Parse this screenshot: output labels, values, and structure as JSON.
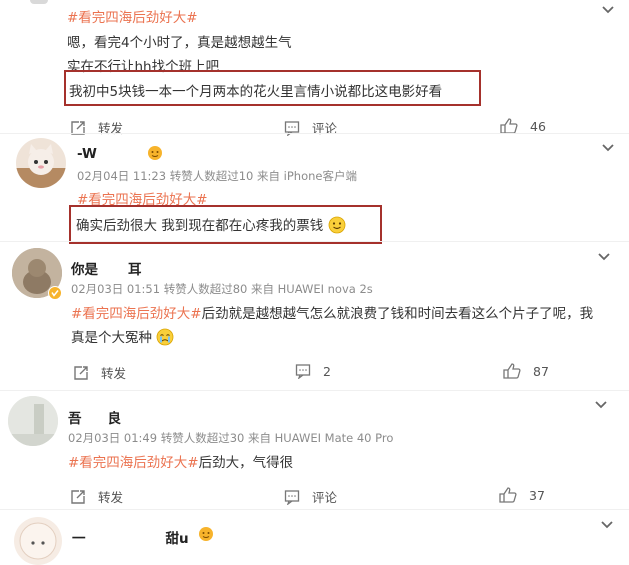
{
  "colors": {
    "tag": "#eb7350",
    "highlight_box": "#a5312c",
    "meta": "#8c8c8c"
  },
  "post1": {
    "hashtag": "#看完四海后劲好大#",
    "line1": "嗯，看完4个小时了，真是越想越生气",
    "line2": "实在不行让hh找个班上吧",
    "line3": "我初中5块钱一本一个月两本的花火里言情小说都比这电影好看",
    "repost_label": "转发",
    "comment_label": "评论",
    "like_count": "46"
  },
  "post2": {
    "name": "-W",
    "meta": "02月04日 11:23 转赞人数超过10 来自 iPhone客户端",
    "hashtag": "#看完四海后劲好大#",
    "text": "确实后劲很大 我到现在都在心疼我的票钱",
    "emoji": "smile-emoji"
  },
  "post3": {
    "name": "你是",
    "name_suffix": "耳",
    "meta": "02月03日 01:51 转赞人数超过80 来自 HUAWEI nova 2s",
    "hashtag": "#看完四海后劲好大#",
    "text1": "后劲就是越想越气怎么就浪费了钱和时间去看这么个片子了呢，我",
    "text2": "真是个大冤种",
    "repost_label": "转发",
    "comment_count": "2",
    "like_count": "87"
  },
  "post4": {
    "name": "吾",
    "name_suffix": "良",
    "meta": "02月03日 01:49 转赞人数超过30 来自 HUAWEI Mate 40 Pro",
    "hashtag": "#看完四海后劲好大#",
    "text": "后劲大，气得很",
    "repost_label": "转发",
    "comment_label": "评论",
    "like_count": "37"
  },
  "post5": {
    "name": "一",
    "name_suffix": "甜u"
  }
}
